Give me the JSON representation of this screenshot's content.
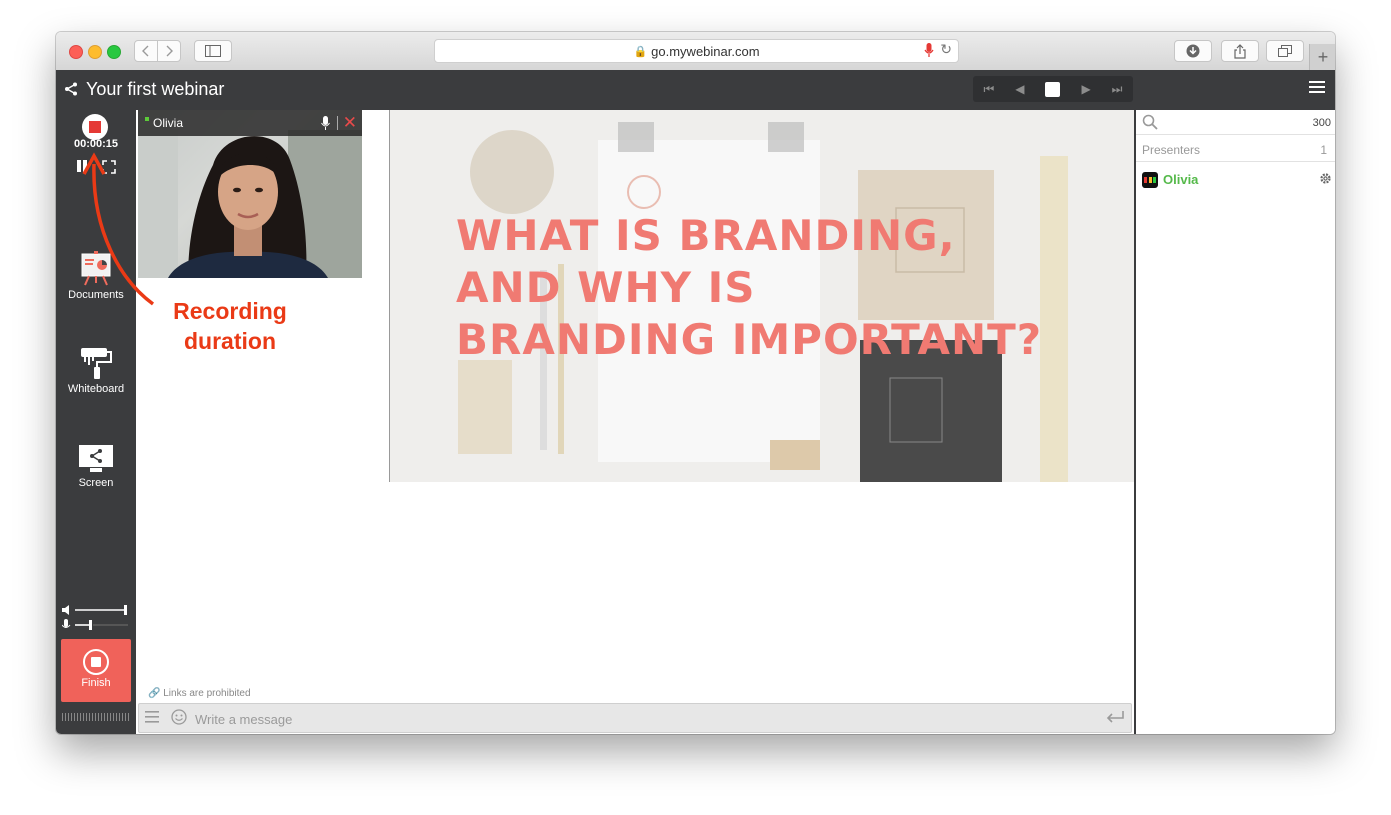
{
  "browser": {
    "url": "go.mywebinar.com"
  },
  "app": {
    "title": "Your first webinar"
  },
  "recording": {
    "duration": "00:00:15"
  },
  "tools": {
    "documents": "Documents",
    "whiteboard": "Whiteboard",
    "screen": "Screen",
    "finish": "Finish"
  },
  "video": {
    "participant_name": "Olivia"
  },
  "slide": {
    "lines": [
      "WHAT IS BRANDING,",
      "AND WHY IS",
      "BRANDING IMPORTANT?"
    ]
  },
  "chat": {
    "notice": "Links are prohibited",
    "placeholder": "Write a message"
  },
  "attendees": {
    "count": "300",
    "presenters_label": "Presenters",
    "presenters_count": "1",
    "presenters": [
      {
        "name": "Olivia"
      }
    ]
  },
  "annotation": {
    "line1": "Recording",
    "line2": "duration"
  },
  "colors": {
    "accent_red": "#ea3a16",
    "finish_button": "#f0625a",
    "presenter_green": "#55b94a",
    "slide_text": "#f07a72",
    "app_dark": "#3b3c3e"
  }
}
